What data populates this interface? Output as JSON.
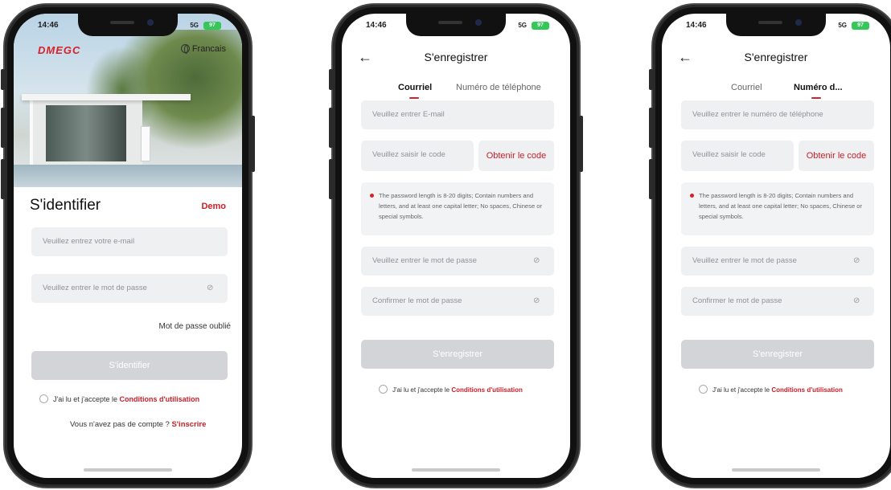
{
  "status": {
    "time": "14:46",
    "network": "5G",
    "battery": "97"
  },
  "login": {
    "logo": "DMEGC",
    "language": "Francais",
    "title": "S'identifier",
    "demo": "Demo",
    "email_placeholder": "Veuillez entrez votre e-mail",
    "password_placeholder": "Veuillez entrer le mot de passe",
    "forgot": "Mot de passe oublié",
    "submit": "S'identifier",
    "terms_prefix": "J'ai lu et j'accepte le",
    "terms_link": "Conditions d'utilisation",
    "no_account": "Vous n'avez pas de compte ?",
    "signup": "S'inscrire"
  },
  "register": {
    "title": "S'enregistrer",
    "tab_email": "Courriel",
    "tab_phone": "Numéro de téléphone",
    "tab_phone_short": "Numéro d...",
    "email_placeholder": "Veuillez entrer E-mail",
    "phone_placeholder": "Veuillez entrer le numéro de téléphone",
    "code_placeholder": "Veuillez saisir le code",
    "get_code": "Obtenir le code",
    "password_rule": "The password length is 8-20 digits; Contain numbers and letters, and at least one capital letter; No spaces, Chinese or special symbols.",
    "password_placeholder": "Veuillez entrer le mot de passe",
    "confirm_placeholder": "Confirmer le mot de passe",
    "submit": "S'enregistrer",
    "terms_prefix": "J'ai lu et j'accepte le",
    "terms_link": "Conditions d'utilisation"
  },
  "colors": {
    "accent": "#d62128",
    "field_bg": "#eff0f2",
    "button_disabled": "#d2d4d8"
  },
  "icons": {
    "eye_off": "eye-off-icon",
    "globe": "globe-icon",
    "back": "arrow-left-icon"
  }
}
